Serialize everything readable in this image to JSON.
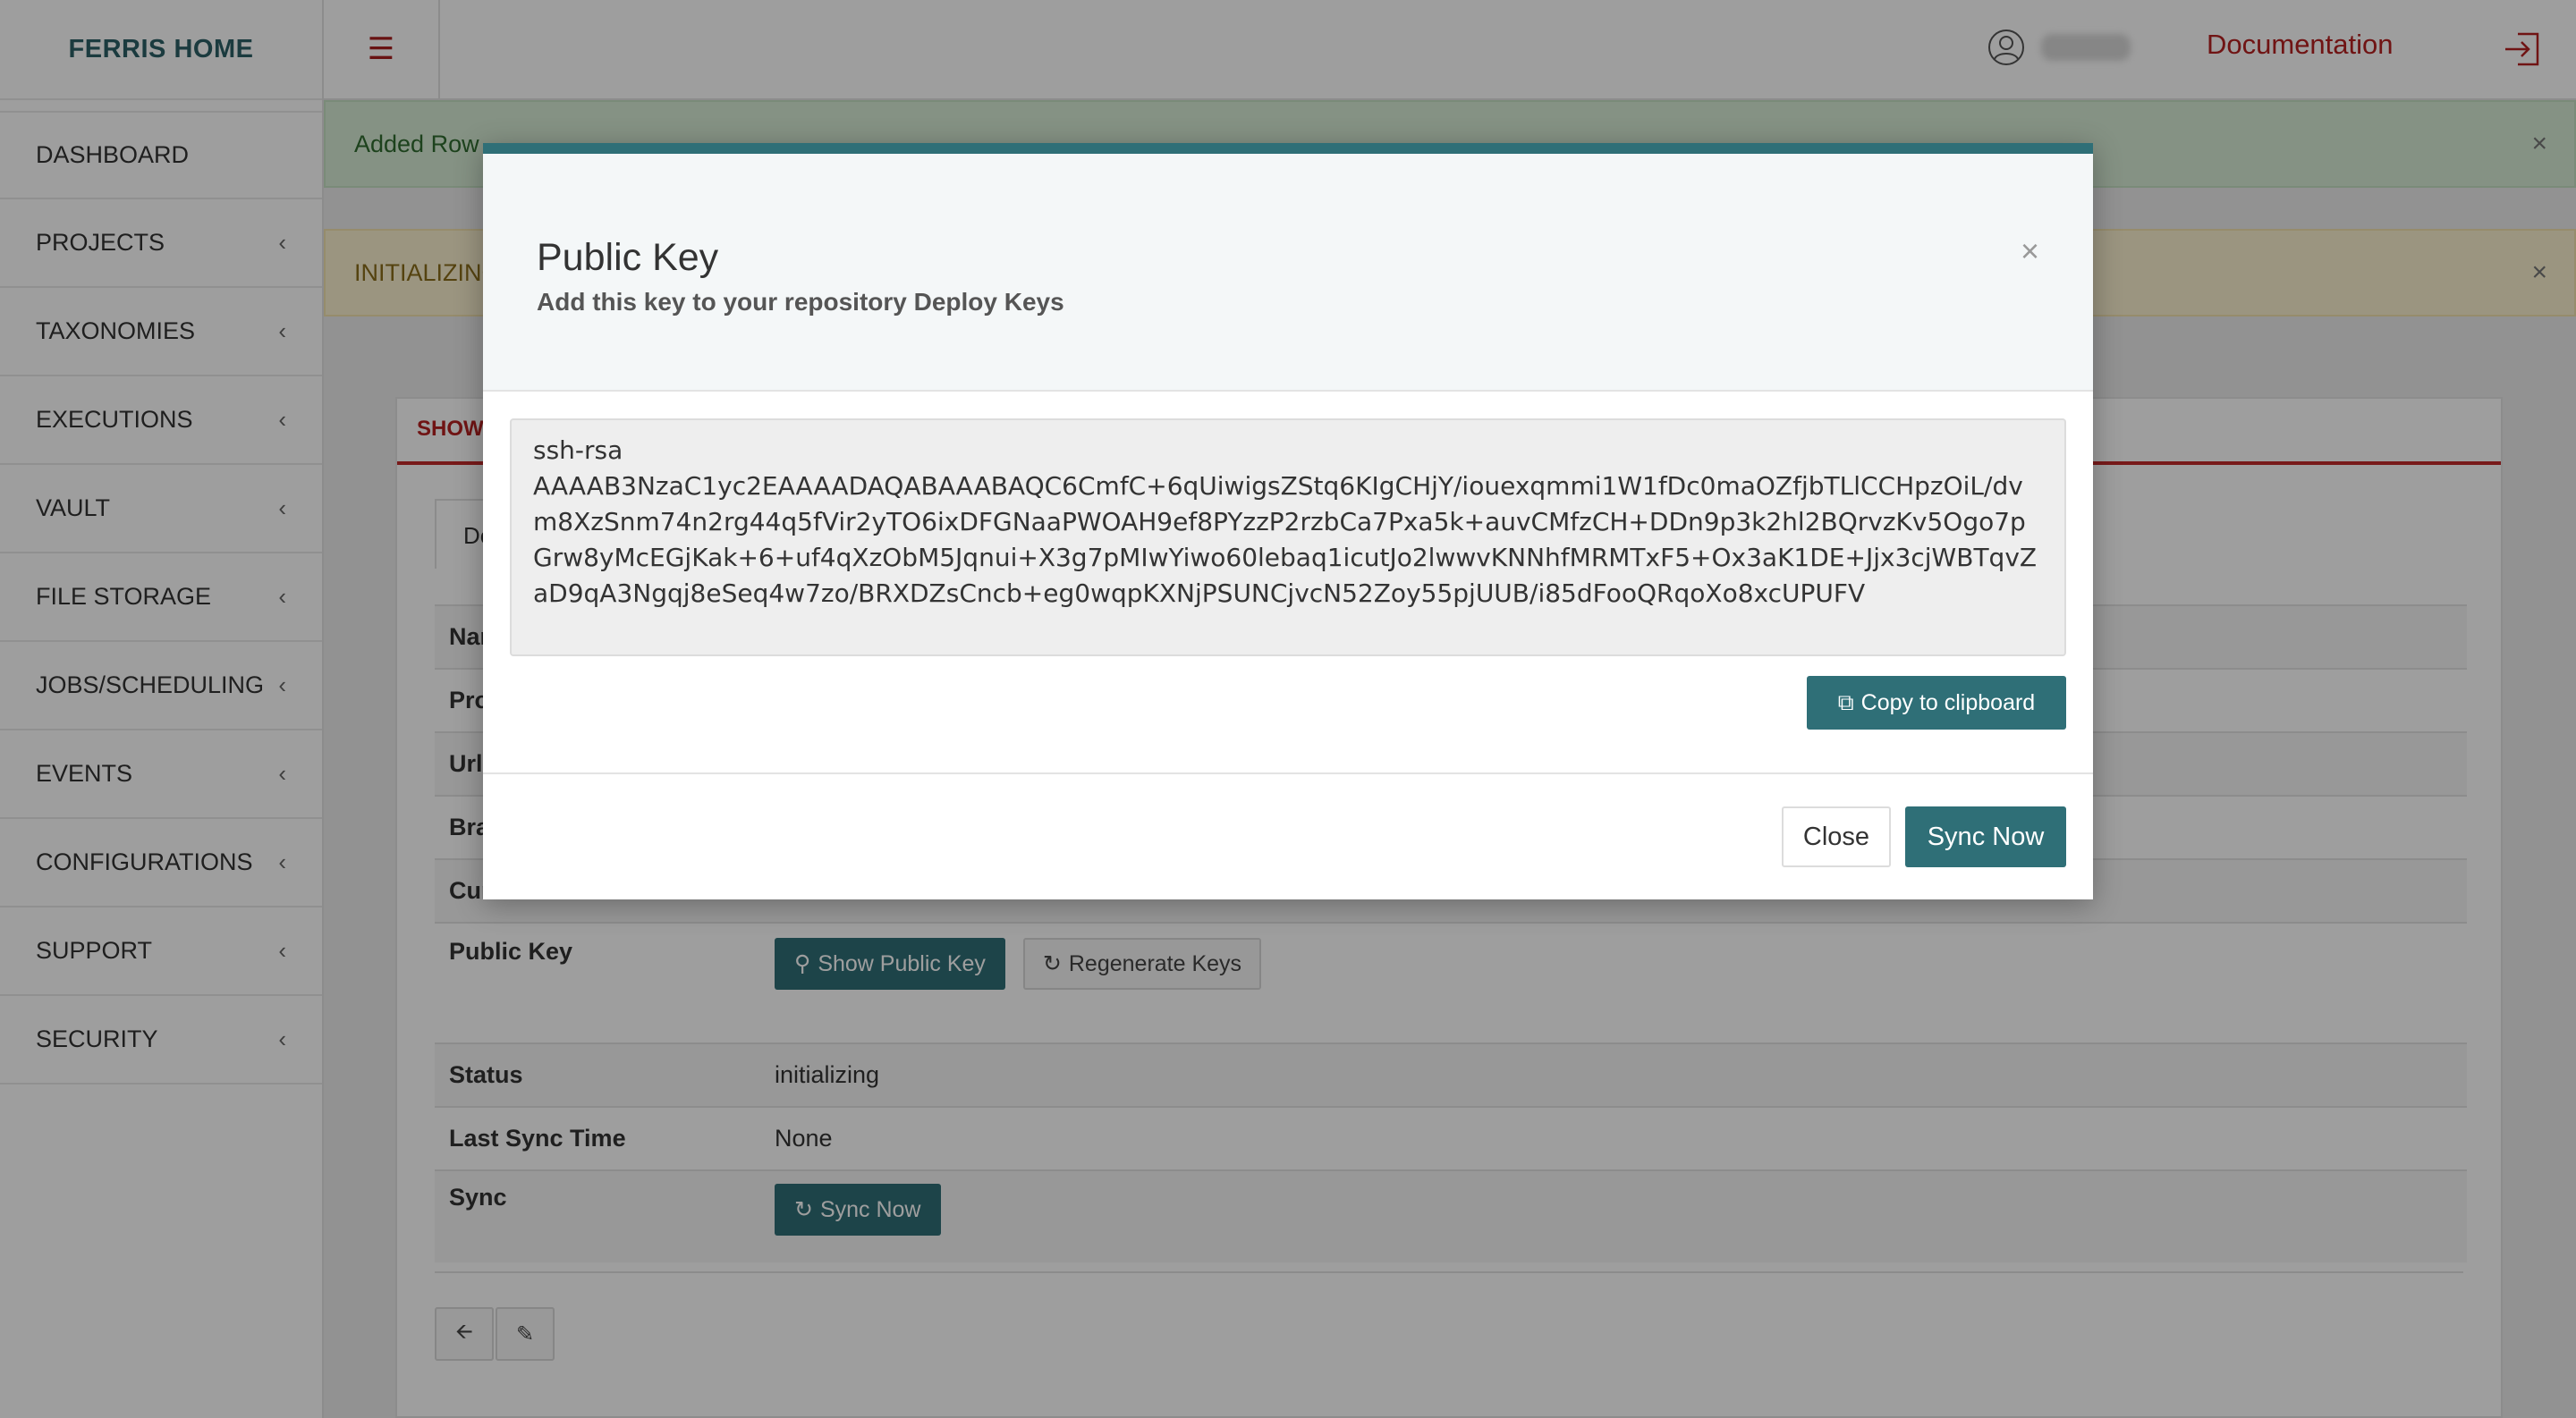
{
  "brand": "FERRIS HOME",
  "topbar": {
    "documentation": "Documentation"
  },
  "sidebar": {
    "items": [
      {
        "label": "DASHBOARD",
        "chevron": ""
      },
      {
        "label": "PROJECTS",
        "chevron": "‹"
      },
      {
        "label": "TAXONOMIES",
        "chevron": "‹"
      },
      {
        "label": "EXECUTIONS",
        "chevron": "‹"
      },
      {
        "label": "VAULT",
        "chevron": "‹"
      },
      {
        "label": "FILE STORAGE",
        "chevron": "‹"
      },
      {
        "label": "JOBS/SCHEDULING",
        "chevron": "‹"
      },
      {
        "label": "EVENTS",
        "chevron": "‹"
      },
      {
        "label": "CONFIGURATIONS",
        "chevron": "‹"
      },
      {
        "label": "SUPPORT",
        "chevron": "‹"
      },
      {
        "label": "SECURITY",
        "chevron": "‹"
      }
    ]
  },
  "alerts": {
    "success": "Added Row",
    "warning": "INITIALIZING",
    "close": "×"
  },
  "panel": {
    "tab": "SHOW",
    "inner_tab": "De",
    "rows": {
      "name_label": "Nar",
      "project_label": "Pro",
      "url_label": "Url",
      "branch_label": "Bra",
      "current_label": "Cur",
      "public_key_label": "Public Key",
      "show_key_button": "Show Public Key",
      "regenerate_button": "Regenerate Keys",
      "status_label": "Status",
      "status_value": "initializing",
      "last_sync_label": "Last Sync Time",
      "last_sync_value": "None",
      "sync_label": "Sync",
      "sync_button": "Sync Now"
    }
  },
  "modal": {
    "title": "Public Key",
    "subtitle": "Add this key to your repository Deploy Keys",
    "close_x": "×",
    "key": "ssh-rsa\nAAAAB3NzaC1yc2EAAAADAQABAAABAQC6CmfC+6qUiwigsZStq6KIgCHjY/iouexqmmi1W1fDc0maOZfjbTLlCCHpzOiL/dvm8XzSnm74n2rg44q5fVir2yTO6ixDFGNaaPWOAH9ef8PYzzP2rzbCa7Pxa5k+auvCMfzCH+DDn9p3k2hl2BQrvzKv5Ogo7pGrw8yMcEGjKak+6+uf4qXzObM5Jqnui+X3g7pMIwYiwo60lebaq1icutJo2lwwvKNNhfMRMTxF5+Ox3aK1DE+Jjx3cjWBTqvZaD9qA3Ngqj8eSeq4w7zo/BRXDZsCncb+eg0wqpKXNjPSUNCjvcN52Zoy55pjUUB/i85dFooQRqoXo8xcUPUFV",
    "copy_button": "Copy to clipboard",
    "close_button": "Close",
    "sync_button": "Sync Now"
  },
  "colors": {
    "accent": "#2f6f77",
    "brand": "#2c5f66",
    "danger": "#b52121"
  }
}
